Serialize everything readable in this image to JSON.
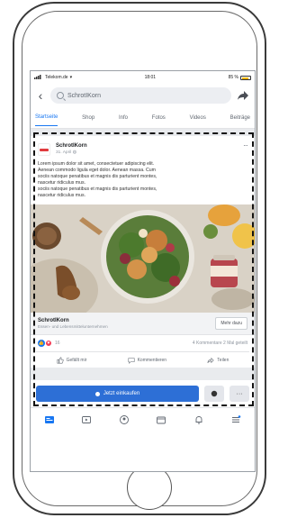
{
  "status_bar": {
    "carrier": "Telekom.de",
    "time": "18:01",
    "battery": "85 %"
  },
  "search": {
    "query": "SchrotIKorn"
  },
  "tabs": [
    {
      "label": "Startseite",
      "active": true
    },
    {
      "label": "Shop",
      "active": false
    },
    {
      "label": "Info",
      "active": false
    },
    {
      "label": "Fotos",
      "active": false
    },
    {
      "label": "Videos",
      "active": false
    },
    {
      "label": "Beiträge",
      "active": false
    }
  ],
  "post": {
    "page_name": "SchrotIKorn",
    "date": "31. April",
    "text_lines": [
      "Lorem ipsum dolor sit amet, consectetuer adipiscing elit.",
      "Aenean commodo ligula eget dolor. Aenean massa. Cum",
      "sociis natoque penatibus et magnis dis parturient montes,",
      "nascetur ridiculus mus.",
      "sociis natoque penatibus et magnis dis parturient montes,",
      "nascetur ridiculus mus."
    ],
    "link_title": "SchrotIKorn",
    "link_subtitle": "Essen- und Lebensmittelunternehmen",
    "more_label": "Mehr dazu",
    "reaction_count": "16",
    "comments": "4 Kommentare",
    "shares": "2 Mal geteilt",
    "like_label": "Gefällt mir",
    "comment_label": "Kommentieren",
    "share_label": "Teilen"
  },
  "bottom": {
    "shop_label": "Jetzt einkaufen",
    "more_icon_text": "···"
  },
  "colors": {
    "accent": "#1877f2",
    "shop_button": "#2d6fd6",
    "logo_red": "#e03a3e"
  }
}
